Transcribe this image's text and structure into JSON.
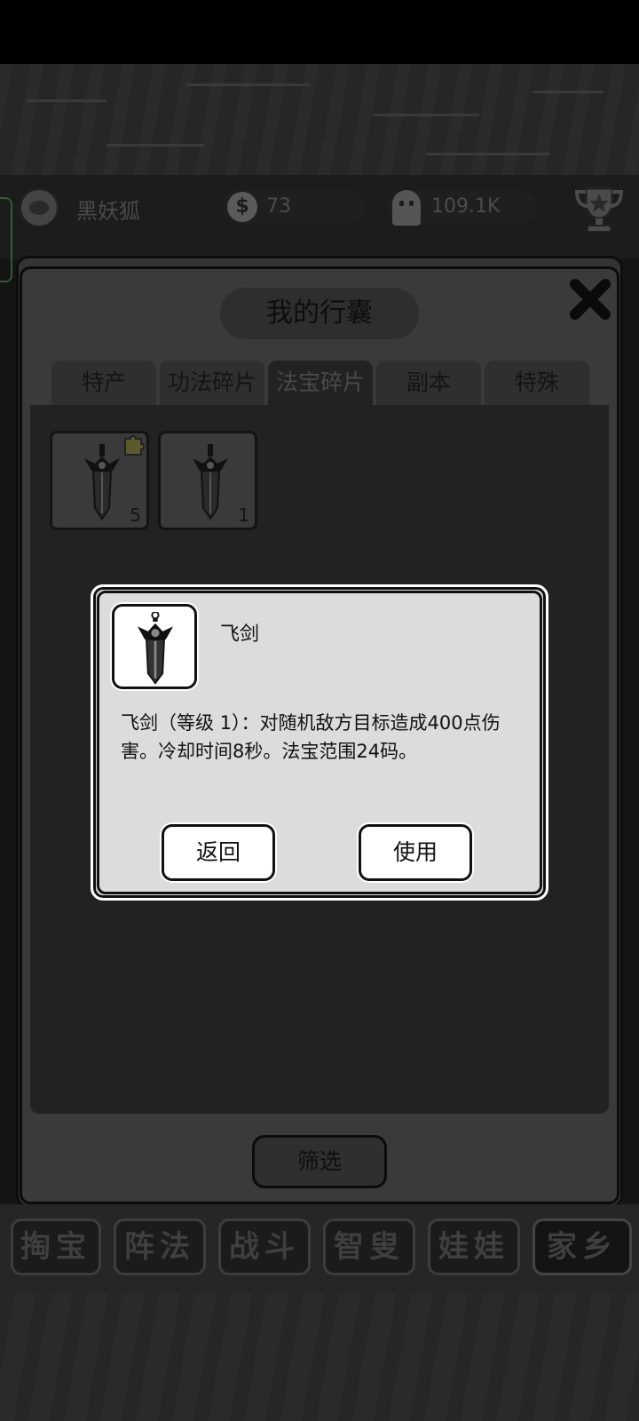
{
  "header": {
    "player_name": "黑妖狐",
    "coins": "73",
    "souls": "109.1K"
  },
  "bag": {
    "title": "我的行囊",
    "tabs": [
      {
        "label": "特产",
        "active": false
      },
      {
        "label": "功法碎片",
        "active": false
      },
      {
        "label": "法宝碎片",
        "active": true
      },
      {
        "label": "副本",
        "active": false
      },
      {
        "label": "特殊",
        "active": false
      }
    ],
    "items": [
      {
        "icon": "sword-icon",
        "count": "5",
        "puzzle_badge": true
      },
      {
        "icon": "sword-icon",
        "count": "1",
        "puzzle_badge": false
      }
    ],
    "filter_label": "筛选"
  },
  "dialog": {
    "item_name": "飞剑",
    "description": "飞剑（等级 1）：对随机敌方目标造成400点伤害。冷却时间8秒。法宝范围24码。",
    "back_label": "返回",
    "use_label": "使用"
  },
  "bottom_nav": [
    "掏宝",
    "阵法",
    "战斗",
    "智叟",
    "娃娃",
    "家乡"
  ]
}
